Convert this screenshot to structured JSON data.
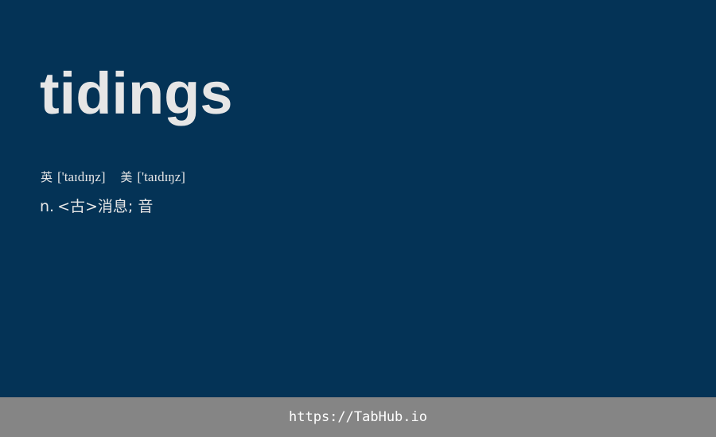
{
  "word": "tidings",
  "phonetics": {
    "uk": {
      "label": "英",
      "text": "['taɪdɪŋz]"
    },
    "us": {
      "label": "美",
      "text": "['taɪdɪŋz]"
    }
  },
  "definition": {
    "pos": "n.",
    "meaning": "<古>消息; 音"
  },
  "footer": {
    "link_text": "https://TabHub.io"
  },
  "colors": {
    "background": "#043356",
    "text": "#e6e6e6",
    "footer_bar": "#858585",
    "footer_text": "#ffffff"
  }
}
